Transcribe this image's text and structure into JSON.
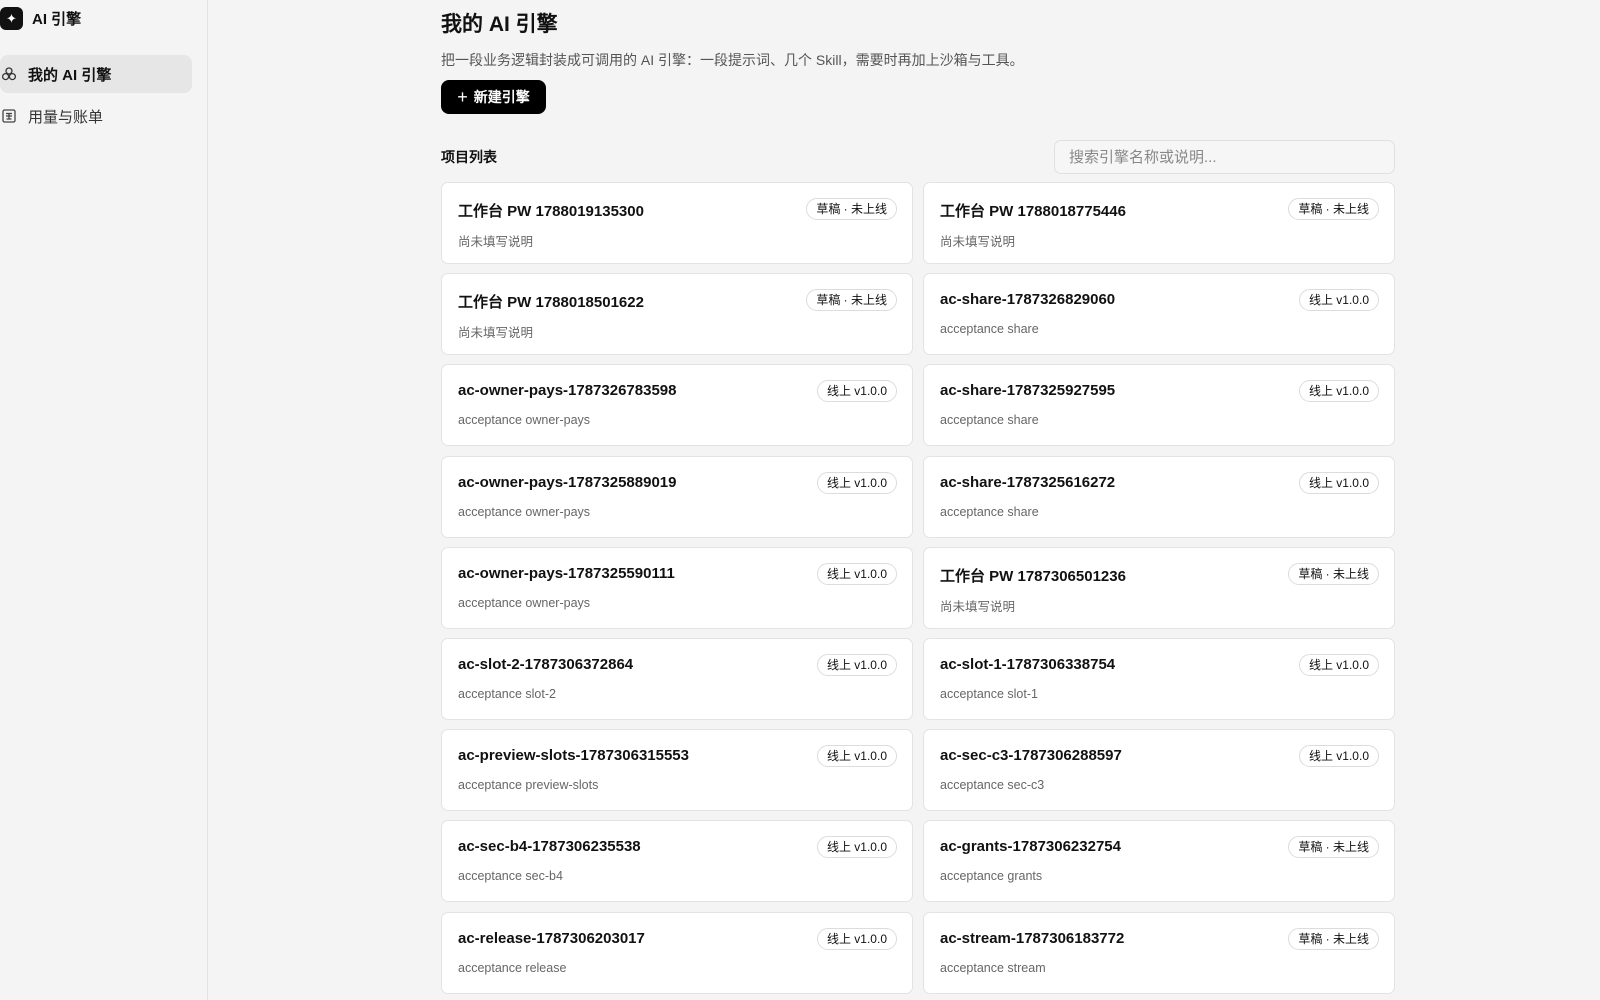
{
  "brand": {
    "logo_icon": "sparkle-icon",
    "name": "AI 引擎"
  },
  "sidebar": {
    "items": [
      {
        "label": "我的 AI 引擎",
        "icon": "engines-icon",
        "active": true
      },
      {
        "label": "用量与账单",
        "icon": "billing-icon",
        "active": false
      }
    ]
  },
  "header": {
    "title": "我的 AI 引擎",
    "description": "把一段业务逻辑封装成可调用的 AI 引擎：一段提示词、几个 Skill，需要时再加上沙箱与工具。",
    "new_button": "新建引擎"
  },
  "list": {
    "title": "项目列表",
    "search_placeholder": "搜索引擎名称或说明...",
    "cards": [
      {
        "title": "工作台 PW 1788019135300",
        "desc": "尚未填写说明",
        "badge": "草稿 · 未上线"
      },
      {
        "title": "工作台 PW 1788018775446",
        "desc": "尚未填写说明",
        "badge": "草稿 · 未上线"
      },
      {
        "title": "工作台 PW 1788018501622",
        "desc": "尚未填写说明",
        "badge": "草稿 · 未上线"
      },
      {
        "title": "ac-share-1787326829060",
        "desc": "acceptance share",
        "badge": "线上 v1.0.0"
      },
      {
        "title": "ac-owner-pays-1787326783598",
        "desc": "acceptance owner-pays",
        "badge": "线上 v1.0.0"
      },
      {
        "title": "ac-share-1787325927595",
        "desc": "acceptance share",
        "badge": "线上 v1.0.0"
      },
      {
        "title": "ac-owner-pays-1787325889019",
        "desc": "acceptance owner-pays",
        "badge": "线上 v1.0.0"
      },
      {
        "title": "ac-share-1787325616272",
        "desc": "acceptance share",
        "badge": "线上 v1.0.0"
      },
      {
        "title": "ac-owner-pays-1787325590111",
        "desc": "acceptance owner-pays",
        "badge": "线上 v1.0.0"
      },
      {
        "title": "工作台 PW 1787306501236",
        "desc": "尚未填写说明",
        "badge": "草稿 · 未上线"
      },
      {
        "title": "ac-slot-2-1787306372864",
        "desc": "acceptance slot-2",
        "badge": "线上 v1.0.0"
      },
      {
        "title": "ac-slot-1-1787306338754",
        "desc": "acceptance slot-1",
        "badge": "线上 v1.0.0"
      },
      {
        "title": "ac-preview-slots-1787306315553",
        "desc": "acceptance preview-slots",
        "badge": "线上 v1.0.0"
      },
      {
        "title": "ac-sec-c3-1787306288597",
        "desc": "acceptance sec-c3",
        "badge": "线上 v1.0.0"
      },
      {
        "title": "ac-sec-b4-1787306235538",
        "desc": "acceptance sec-b4",
        "badge": "线上 v1.0.0"
      },
      {
        "title": "ac-grants-1787306232754",
        "desc": "acceptance grants",
        "badge": "草稿 · 未上线"
      },
      {
        "title": "ac-release-1787306203017",
        "desc": "acceptance release",
        "badge": "线上 v1.0.0"
      },
      {
        "title": "ac-stream-1787306183772",
        "desc": "acceptance stream",
        "badge": "草稿 · 未上线"
      }
    ]
  }
}
